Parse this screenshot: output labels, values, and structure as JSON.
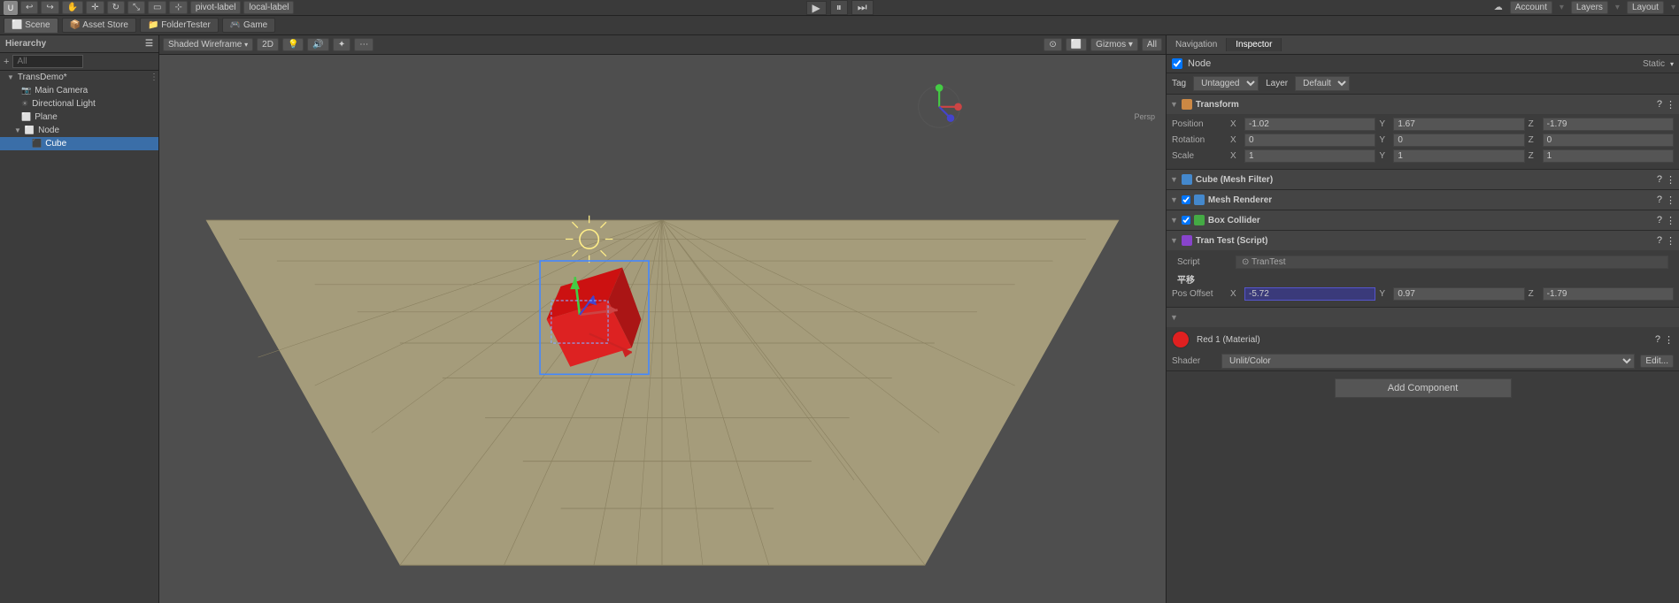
{
  "topbar": {
    "tools": [
      "pivot-label",
      "local-label"
    ],
    "tabs": [
      "Scene",
      "Asset Store",
      "FolderTester",
      "Game"
    ],
    "play_btn": "▶",
    "pause_btn": "⏸",
    "step_btn": "⏭",
    "account_label": "Account",
    "layers_label": "Layers",
    "layout_label": "Layout",
    "cloud_label": "☁"
  },
  "scene_toolbar": {
    "shading_label": "Shaded Wireframe",
    "mode_2d": "2D",
    "gizmos_label": "Gizmos ▾",
    "all_label": "All"
  },
  "hierarchy": {
    "title": "Hierarchy",
    "search_placeholder": "All",
    "root_name": "TransDemo*",
    "items": [
      {
        "name": "Main Camera",
        "indent": 1,
        "icon": "📷"
      },
      {
        "name": "Directional Light",
        "indent": 1,
        "icon": "☀"
      },
      {
        "name": "Plane",
        "indent": 1,
        "icon": "⬜"
      },
      {
        "name": "Node",
        "indent": 1,
        "icon": "⬜",
        "expanded": true
      },
      {
        "name": "Cube",
        "indent": 2,
        "icon": "⬛",
        "selected": true
      }
    ]
  },
  "inspector": {
    "nav_tab": "Navigation",
    "insp_tab": "Inspector",
    "node_name": "Node",
    "static_label": "Static",
    "tag_label": "Tag",
    "tag_value": "Untagged",
    "layer_label": "Layer",
    "layer_value": "Default",
    "transform": {
      "title": "Transform",
      "position": {
        "x": "-1.02",
        "y": "1.67",
        "z": "-1.79"
      },
      "rotation": {
        "x": "0",
        "y": "0",
        "z": "0"
      },
      "scale": {
        "x": "1",
        "y": "1",
        "z": "1"
      }
    },
    "cube_mesh_filter": {
      "title": "Cube (Mesh Filter)"
    },
    "mesh_renderer": {
      "title": "Mesh Renderer"
    },
    "box_collider": {
      "title": "Box Collider"
    },
    "tran_test": {
      "title": "Tran Test (Script)",
      "script_label": "Script",
      "script_value": "⊙ TranTest",
      "section_label": "平移",
      "pos_offset_label": "Pos Offset",
      "pos_x": "-5.72",
      "pos_y": "0.97",
      "pos_z": "-1.79"
    },
    "material": {
      "title": "Red 1 (Material)",
      "shader_label": "Shader",
      "shader_value": "Unlit/Color",
      "edit_label": "Edit..."
    },
    "add_component": "Add Component"
  },
  "persp_label": "Persp"
}
